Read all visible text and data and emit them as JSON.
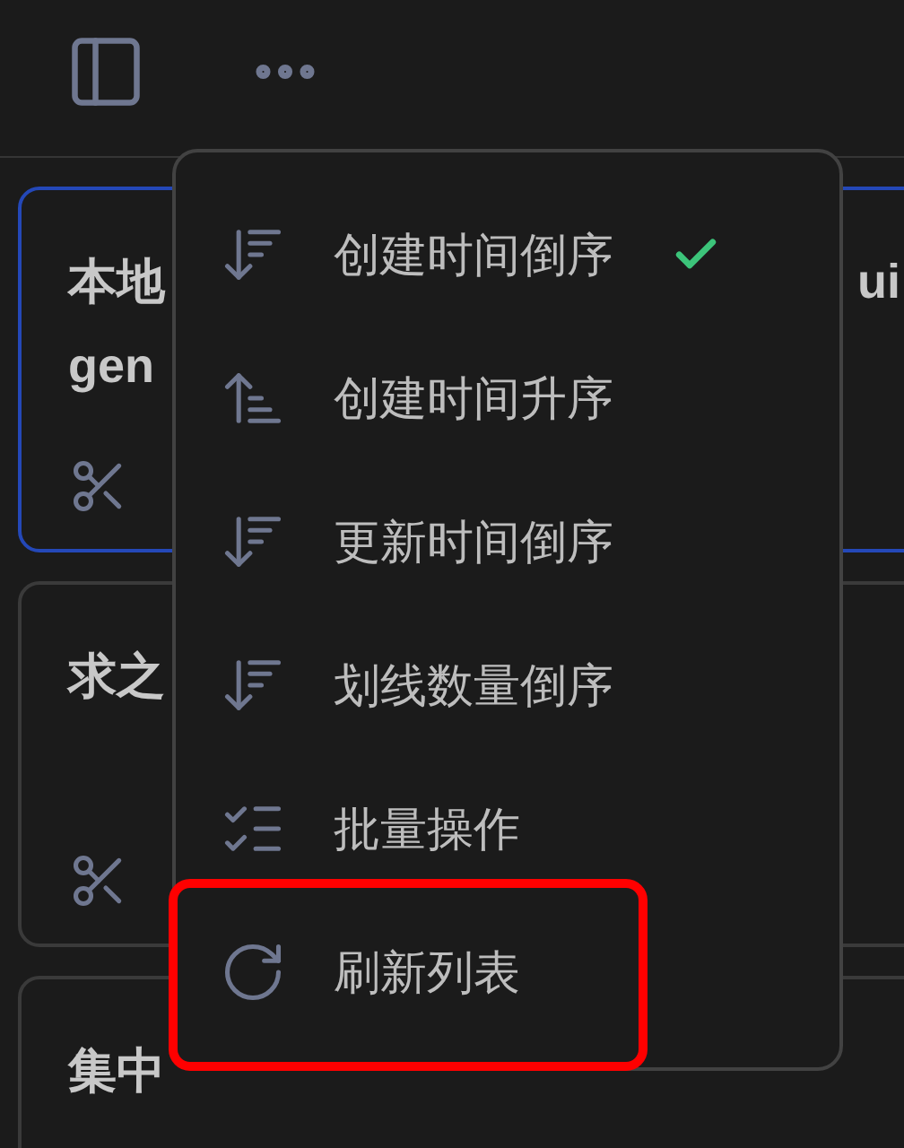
{
  "cards": [
    {
      "title_lines": [
        "本地",
        "gen"
      ],
      "title_right": "ui",
      "selected": true,
      "actions": [
        {
          "kind": "clip"
        }
      ]
    },
    {
      "title_lines": [
        "求之"
      ],
      "selected": false,
      "actions": [
        {
          "kind": "clip"
        }
      ]
    },
    {
      "title_lines": [
        "集中"
      ],
      "selected": false
    }
  ],
  "menu": {
    "items": [
      {
        "kind": "sort-desc",
        "label": "创建时间倒序",
        "selected": true
      },
      {
        "kind": "sort-asc",
        "label": "创建时间升序",
        "selected": false
      },
      {
        "kind": "sort-desc",
        "label": "更新时间倒序",
        "selected": false
      },
      {
        "kind": "sort-desc",
        "label": "划线数量倒序",
        "selected": false
      },
      {
        "kind": "multi-select",
        "label": "批量操作",
        "selected": false
      },
      {
        "kind": "refresh",
        "label": "刷新列表",
        "selected": false
      }
    ]
  }
}
